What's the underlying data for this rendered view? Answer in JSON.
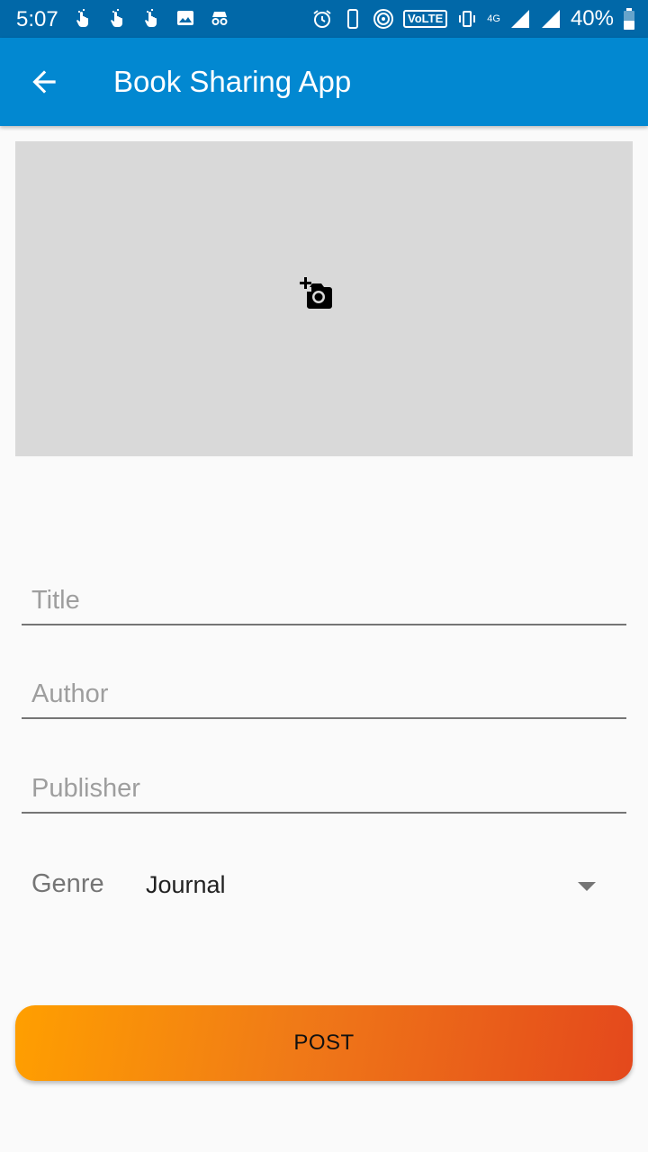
{
  "status_bar": {
    "time": "5:07",
    "volte_label": "VoLTE",
    "network_label": "4G",
    "battery": "40%"
  },
  "app_bar": {
    "title": "Book Sharing App",
    "back_icon": "arrow-back-icon"
  },
  "image_picker": {
    "icon": "add-a-photo-icon"
  },
  "form": {
    "title_placeholder": "Title",
    "title_value": "",
    "author_placeholder": "Author",
    "author_value": "",
    "publisher_placeholder": "Publisher",
    "publisher_value": "",
    "genre_label": "Genre",
    "genre_selected": "Journal"
  },
  "actions": {
    "post_label": "POST"
  },
  "colors": {
    "status_bar": "#0168a8",
    "app_bar": "#0288d1",
    "button_gradient_start": "#ff9f00",
    "button_gradient_end": "#e4481c"
  }
}
